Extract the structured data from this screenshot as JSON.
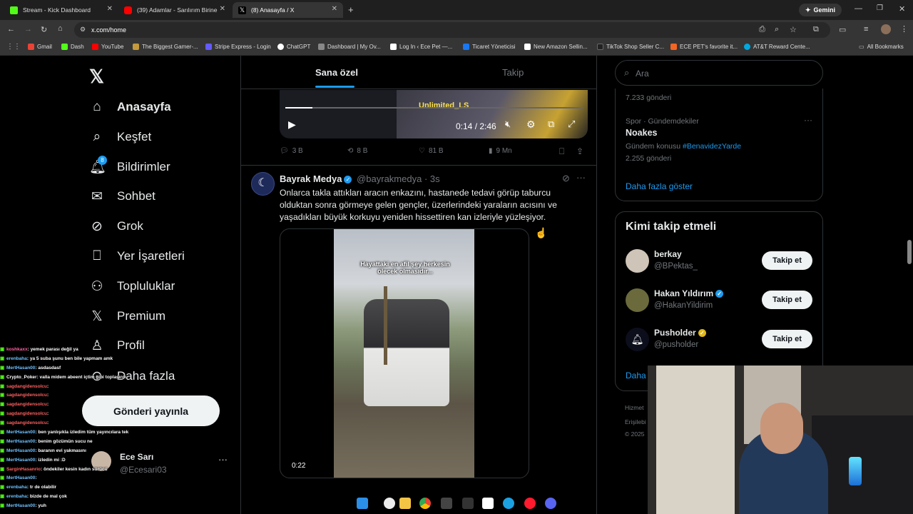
{
  "browser": {
    "tabs": [
      {
        "title": "Stream - Kick Dashboard",
        "fav_color": "#53fc18",
        "active": false
      },
      {
        "title": "(39) Adamlar - Sarılırım Birine",
        "fav_color": "#ff0000",
        "active": false
      },
      {
        "title": "(8) Anasayfa / X",
        "fav_color": "#000000",
        "active": true
      }
    ],
    "gemini_label": "Gemini",
    "url": "x.com/home",
    "bookmarks": [
      {
        "label": "Gmail",
        "color": "#ea4335"
      },
      {
        "label": "Dash",
        "color": "#53fc18"
      },
      {
        "label": "YouTube",
        "color": "#ff0000"
      },
      {
        "label": "The Biggest Gamer-...",
        "color": "#c49a3c"
      },
      {
        "label": "Stripe Express - Login",
        "color": "#635bff"
      },
      {
        "label": "ChatGPT",
        "color": "#ffffff"
      },
      {
        "label": "Dashboard | My Ov...",
        "color": "#888888"
      },
      {
        "label": "Log In ‹ Ece Pet —...",
        "color": "#ffffff"
      },
      {
        "label": "Ticaret Yöneticisi",
        "color": "#1877f2"
      },
      {
        "label": "New Amazon Sellin...",
        "color": "#ffffff"
      },
      {
        "label": "TikTok Shop Seller C...",
        "color": "#222222"
      },
      {
        "label": "ECE PET's favorite it...",
        "color": "#f26522"
      },
      {
        "label": "AT&T Reward Cente...",
        "color": "#00a8e0"
      }
    ],
    "all_bookmarks": "All Bookmarks"
  },
  "sidebar": {
    "items": [
      {
        "label": "Anasayfa",
        "icon": "home-icon"
      },
      {
        "label": "Keşfet",
        "icon": "search-icon"
      },
      {
        "label": "Bildirimler",
        "icon": "bell-icon",
        "badge": "8"
      },
      {
        "label": "Sohbet",
        "icon": "mail-icon"
      },
      {
        "label": "Grok",
        "icon": "grok-icon"
      },
      {
        "label": "Yer İşaretleri",
        "icon": "bookmark-icon"
      },
      {
        "label": "Topluluklar",
        "icon": "communities-icon"
      },
      {
        "label": "Premium",
        "icon": "x-logo-icon"
      },
      {
        "label": "Profil",
        "icon": "person-icon"
      },
      {
        "label": "Daha fazla",
        "icon": "more-circle-icon"
      }
    ],
    "post_button": "Gönderi yayınla",
    "account": {
      "name": "Ece Sarı",
      "handle": "@Ecesari03"
    }
  },
  "timeline": {
    "tabs": [
      "Sana özel",
      "Takip"
    ],
    "video1": {
      "time": "0:14 / 2:46",
      "overlay_text": "Unlimited_LS"
    },
    "post1_stats": {
      "replies": "3 B",
      "reposts": "8 B",
      "likes": "81 B",
      "views": "9 Mn"
    },
    "post2": {
      "name": "Bayrak Medya",
      "handle": "@bayrakmedya",
      "time": "3s",
      "text": "Onlarca takla attıkları aracın enkazını, hastanede tedavi görüp taburcu olduktan sonra görmeye gelen gençler, üzerlerindeki yaraların acısını ve yaşadıkları büyük korkuyu yeniden hissettiren kan izleriyle yüzleşiyor.",
      "video_caption": "Hayattaki en afil şey herkesin ölecek olmasıdır...",
      "duration": "0:22"
    }
  },
  "rightcol": {
    "search_placeholder": "Ara",
    "trends": [
      {
        "count": "7.233 gönderi"
      },
      {
        "category": "Spor · Gündemdekiler",
        "name": "Noakes",
        "context_prefix": "Gündem konusu",
        "context_tag": "#BenavidezYarde",
        "count": "2.255 gönderi"
      }
    ],
    "show_more": "Daha fazla göster",
    "who_to_follow": {
      "title": "Kimi takip etmeli",
      "accounts": [
        {
          "name": "berkay",
          "handle": "@BPektas_",
          "verified": ""
        },
        {
          "name": "Hakan Yıldırım",
          "handle": "@HakanYildirim",
          "verified": "blue"
        },
        {
          "name": "Pusholder",
          "handle": "@pusholder",
          "verified": "gold"
        }
      ],
      "follow_label": "Takip et",
      "show_more": "Daha"
    },
    "footer": [
      "Hizmet",
      "Erişilebi",
      "© 2025"
    ]
  },
  "chat": [
    {
      "user": "koshkaxx",
      "msg": ": yemek parası değil ya",
      "color": "#ff5fa2"
    },
    {
      "user": "erenbaha",
      "msg": ": ya 5 suba şunu ben bile yapmam amk",
      "color": "#6ec1ff"
    },
    {
      "user": "MertHasan00",
      "msg": ": asdasdasf",
      "color": "#6ec1ff"
    },
    {
      "user": "Crypto_Poker",
      "msg": ": valla midem abeent içtim gibi toplaşırdı",
      "color": "#ffffff"
    },
    {
      "user": "sagdangidensolcu",
      "msg": ":",
      "color": "#ff5f5f"
    },
    {
      "user": "sagdangidensolcu",
      "msg": ":",
      "color": "#ff5f5f"
    },
    {
      "user": "sagdangidensolcu",
      "msg": ":",
      "color": "#ff5f5f"
    },
    {
      "user": "sagdangidensolcu",
      "msg": ":",
      "color": "#ff5f5f"
    },
    {
      "user": "sagdangidensolcu",
      "msg": ":",
      "color": "#ff5f5f"
    },
    {
      "user": "MertHasan00",
      "msg": ": ben yanlışıkla izledim tüm yayıncılara tek tek izletiyom",
      "color": "#6ec1ff"
    },
    {
      "user": "MertHasan00",
      "msg": ": benim gözümün sucu ne",
      "color": "#6ec1ff"
    },
    {
      "user": "MertHasan00",
      "msg": ": baranın evi yakmasını",
      "color": "#6ec1ff"
    },
    {
      "user": "MertHasan00",
      "msg": ": izledin mi :D",
      "color": "#6ec1ff"
    },
    {
      "user": "SarginHasanrio",
      "msg": ": öndekiler kesin kadın sürücü",
      "color": "#ff5f5f"
    },
    {
      "user": "MertHasan00",
      "msg": ":",
      "color": "#6ec1ff"
    },
    {
      "user": "erenbaha",
      "msg": ": tr de olabilir",
      "color": "#6ec1ff"
    },
    {
      "user": "erenbaha",
      "msg": ": bizde de mal çok",
      "color": "#6ec1ff"
    },
    {
      "user": "MertHasan00",
      "msg": ": yuh",
      "color": "#6ec1ff"
    }
  ]
}
